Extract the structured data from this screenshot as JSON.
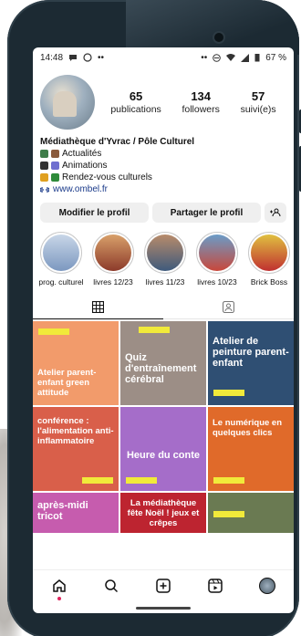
{
  "status": {
    "time": "14:48",
    "dots_left": "••",
    "dots_right": "••",
    "battery": "67 %"
  },
  "stats": [
    {
      "num": "65",
      "label": "publications"
    },
    {
      "num": "134",
      "label": "followers"
    },
    {
      "num": "57",
      "label": "suivi(e)s"
    }
  ],
  "bio": {
    "name": "Médiathèque d'Yvrac / Pôle Culturel",
    "lines": [
      "Actualités",
      "Animations",
      "Rendez-vous culturels"
    ],
    "link": "www.ombel.fr"
  },
  "actions": {
    "edit": "Modifier le profil",
    "share": "Partager le profil"
  },
  "highlights": [
    "prog. culturel",
    "livres 12/23",
    "livres 11/23",
    "livres 10/23",
    "Brick Boss"
  ],
  "posts": [
    {
      "title": "Atelier parent-enfant green attitude",
      "bg": "#f29b6b"
    },
    {
      "title": "Quiz d'entraînement cérébral",
      "bg": "#9c8e86"
    },
    {
      "title": "Atelier de peinture parent-enfant",
      "bg": "#2f4f73"
    },
    {
      "title": "conférence : l'alimentation anti-inflammatoire",
      "bg": "#d95f4a"
    },
    {
      "title": "Heure du conte",
      "bg": "#a56dc9"
    },
    {
      "title": "Le numérique en quelques clics",
      "bg": "#e06a2a"
    },
    {
      "title": "après-midi tricot",
      "bg": "#c65cae"
    },
    {
      "title": "La médiathèque fête Noël ! jeux et crêpes",
      "bg": "#bd2430"
    },
    {
      "title": "",
      "bg": "#6a7a52"
    }
  ],
  "colors": {
    "accent": "#e0245e",
    "link": "#1a3a8a"
  }
}
